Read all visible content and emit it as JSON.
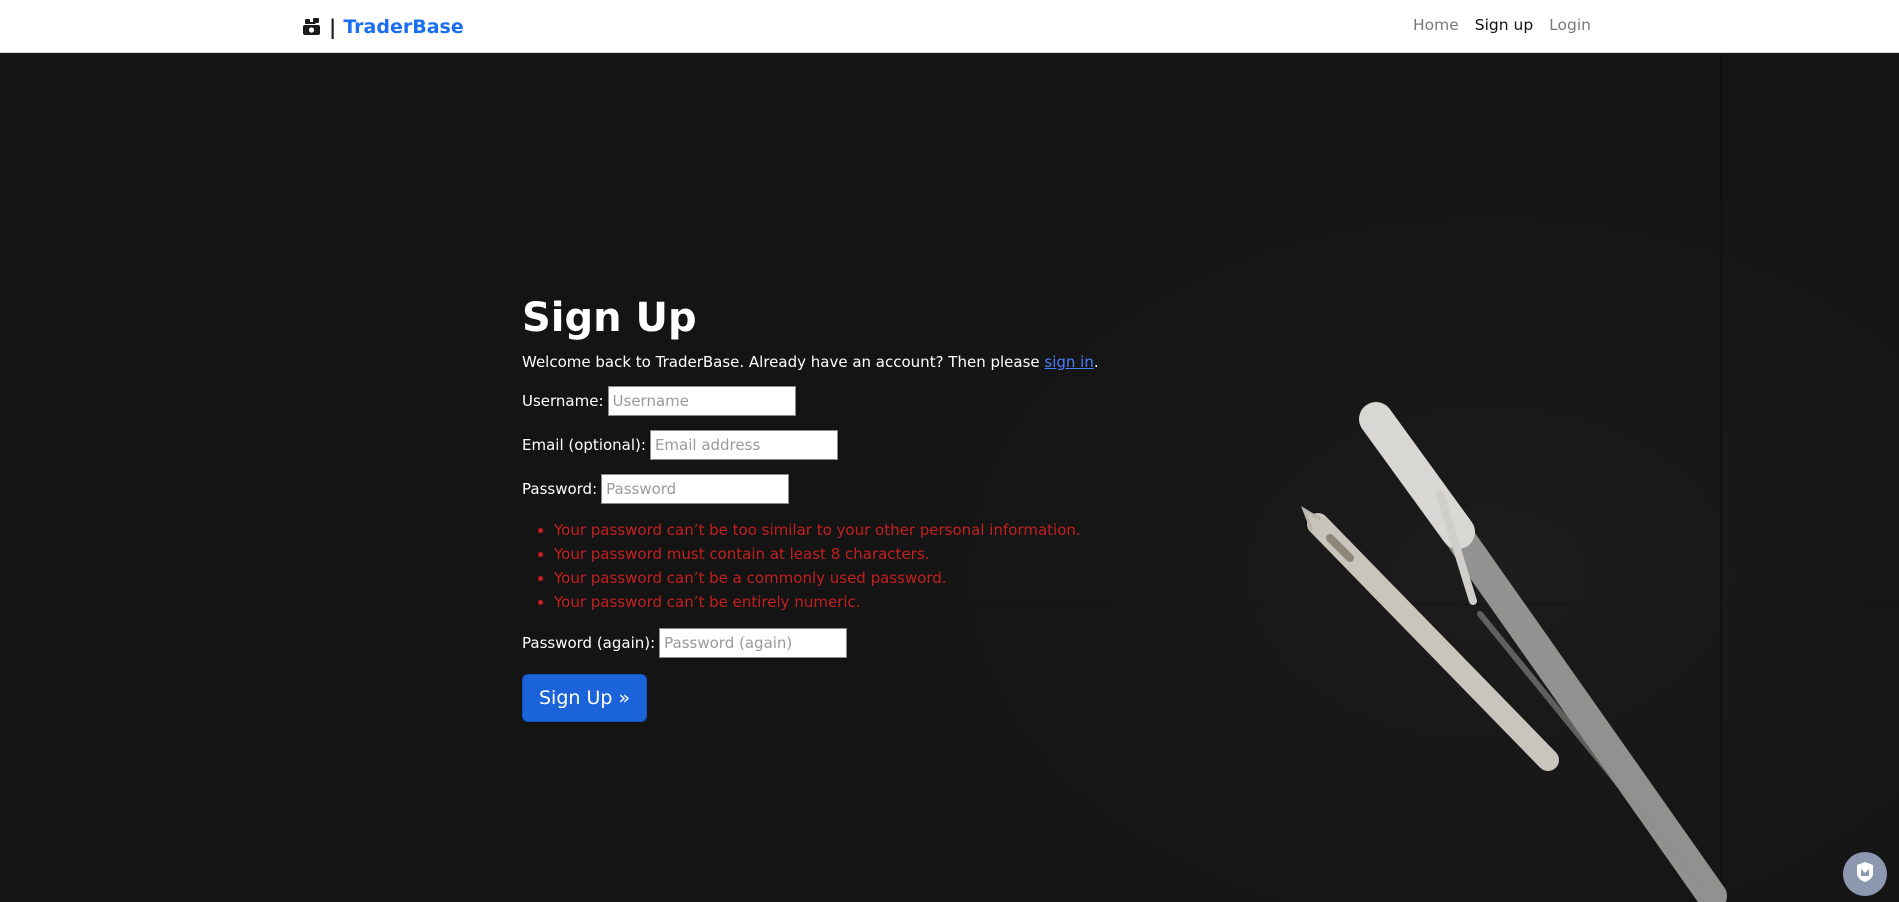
{
  "navbar": {
    "brand_separator": "|",
    "brand_name": "TraderBase",
    "links": [
      {
        "label": "Home"
      },
      {
        "label": "Sign up"
      },
      {
        "label": "Login"
      }
    ]
  },
  "form": {
    "title": "Sign Up",
    "intro_text": "Welcome back to TraderBase. Already have an account? Then please ",
    "intro_link": "sign in",
    "intro_end": ".",
    "username_label": "Username:",
    "username_placeholder": "Username",
    "email_label": "Email (optional):",
    "email_placeholder": "Email address",
    "password_label": "Password:",
    "password_placeholder": "Password",
    "password_help": [
      "Your password can’t be too similar to your other personal information.",
      "Your password must contain at least 8 characters.",
      "Your password can’t be a commonly used password.",
      "Your password can’t be entirely numeric."
    ],
    "password2_label": "Password (again):",
    "password2_placeholder": "Password (again)",
    "submit_label": "Sign Up »"
  },
  "colors": {
    "brand": "#1a6ef0",
    "error": "#c41f1f",
    "button": "#1a63d8",
    "background": "#171717"
  },
  "icons": {
    "brand": "money-icon",
    "widget": "shield-icon"
  }
}
